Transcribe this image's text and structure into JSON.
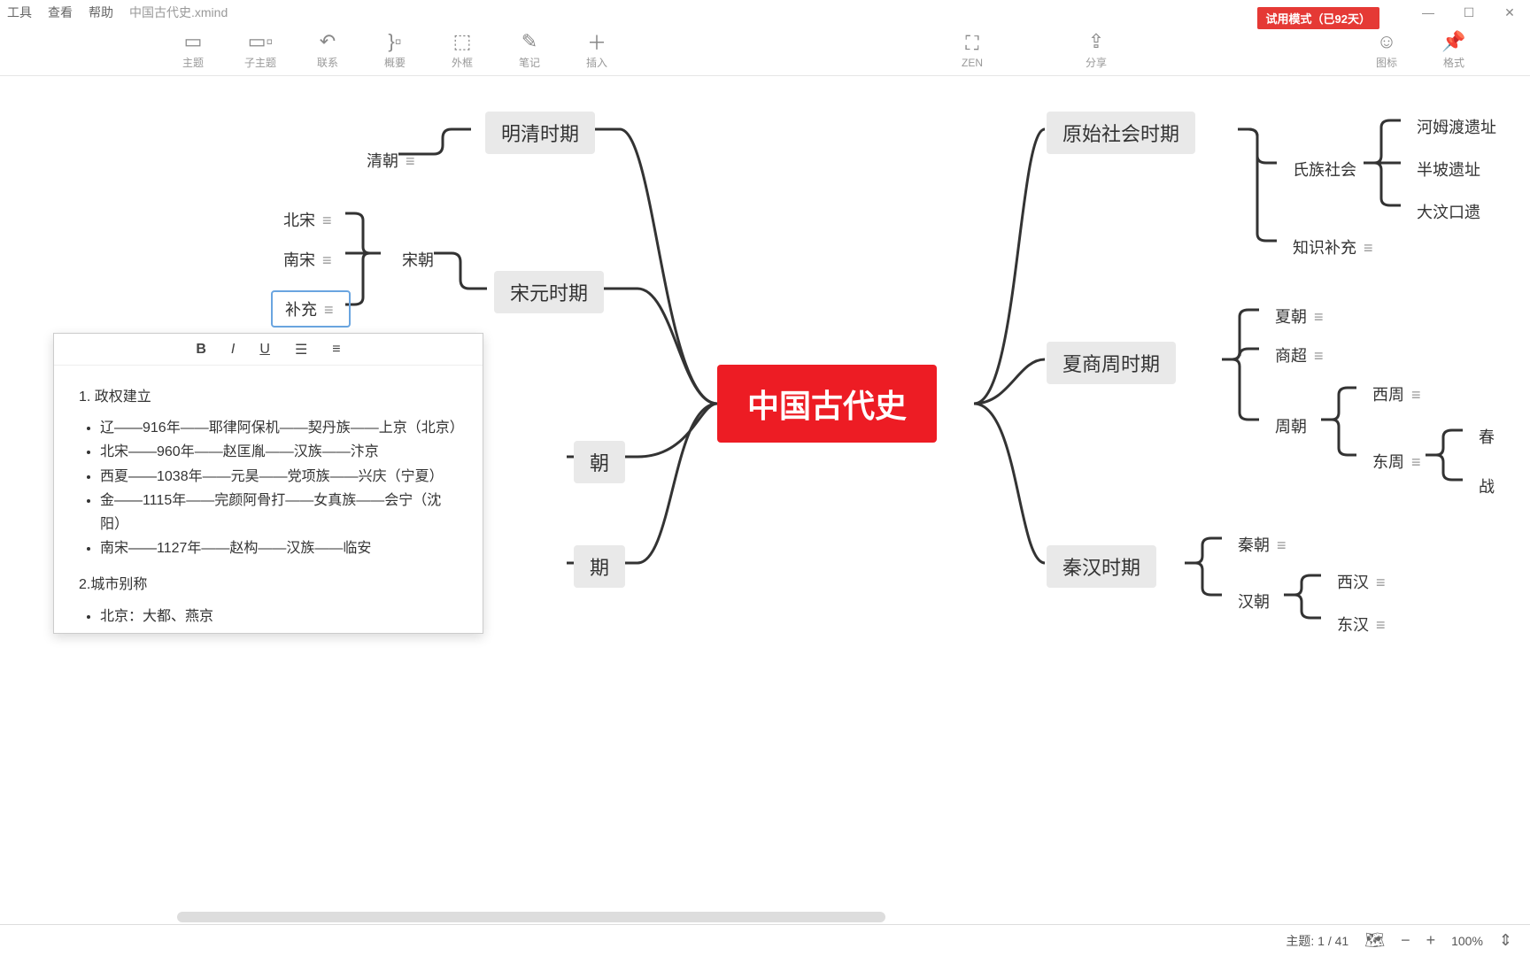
{
  "menu": {
    "tool": "工具",
    "view": "查看",
    "help": "帮助",
    "filename": "中国古代史.xmind"
  },
  "trial": "试用模式（已92天）",
  "toolbar": {
    "topic": "主题",
    "subtopic": "子主题",
    "relation": "联系",
    "summary": "概要",
    "boundary": "外框",
    "note": "笔记",
    "insert": "插入",
    "zen": "ZEN",
    "share": "分享",
    "emoji": "图标",
    "format": "格式"
  },
  "root": "中国古代史",
  "left": {
    "mingqing": "明清时期",
    "qing": "清朝",
    "songyuan": "宋元时期",
    "song": "宋朝",
    "beisong": "北宋",
    "nansong": "南宋",
    "buchong": "补充",
    "chao_partial": "朝",
    "qi_partial": "期"
  },
  "right": {
    "yuanshi": "原始社会时期",
    "shizu": "氏族社会",
    "zhishi": "知识补充",
    "hemudu": "河姆渡遗址",
    "banpo": "半坡遗址",
    "dawenkou": "大汶口遗",
    "xiashangzhou": "夏商周时期",
    "xia": "夏朝",
    "shang": "商超",
    "zhou": "周朝",
    "xizhou": "西周",
    "dongzhou": "东周",
    "chun": "春",
    "zhan": "战",
    "qinhan": "秦汉时期",
    "qin": "秦朝",
    "han": "汉朝",
    "xihan": "西汉",
    "donghan": "东汉"
  },
  "note": {
    "h1": "1. 政权建立",
    "b1": "辽——916年——耶律阿保机——契丹族——上京（北京）",
    "b2": "北宋——960年——赵匡胤——汉族——汴京",
    "b3": "西夏——1038年——元昊——党项族——兴庆（宁夏）",
    "b4": "金——1115年——完颜阿骨打——女真族——会宁（沈阳）",
    "b5": "南宋——1127年——赵构——汉族——临安",
    "h2": "2.城市别称",
    "b6": "北京：大都、燕京"
  },
  "status": {
    "topic": "主题: 1 / 41",
    "zoom": "100%"
  }
}
